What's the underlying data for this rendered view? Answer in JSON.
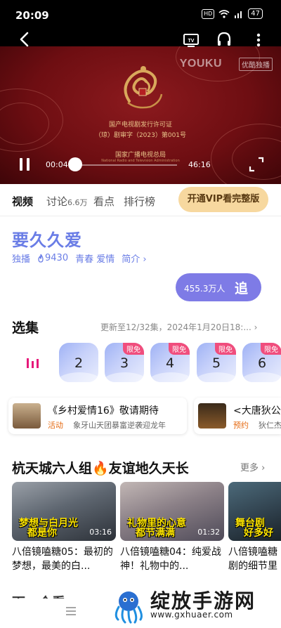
{
  "status_bar": {
    "time": "20:09",
    "hd": "HD",
    "battery": "47"
  },
  "player": {
    "brand": "YOUKU",
    "badge": "优酷独播",
    "cert_line1": "国产电视剧发行许可证",
    "cert_line2": "（琼）剧审字（2023）第001号",
    "cert_line3": "国家广播电视总局",
    "cert_line4": "National Radio and Television Administration",
    "current_time": "00:04",
    "total_time": "46:16",
    "progress": 0.0015
  },
  "tabs": [
    {
      "label": "视频",
      "count": ""
    },
    {
      "label": "讨论",
      "count": "6.6万"
    },
    {
      "label": "看点",
      "count": ""
    },
    {
      "label": "排行榜",
      "count": ""
    }
  ],
  "vip_button": "开通VIP看完整版",
  "show": {
    "title": "要久久爱",
    "exclusive": "独播",
    "heat": "9430",
    "genres": "青春 爱情",
    "intro": "简介"
  },
  "follow": {
    "count": "455.3万人",
    "label": "追"
  },
  "episodes": {
    "title": "选集",
    "update": "更新至12/32集，2024年1月20日18:...",
    "items": [
      {
        "num": "2",
        "tag": ""
      },
      {
        "num": "3",
        "tag": "限免"
      },
      {
        "num": "4",
        "tag": "限免"
      },
      {
        "num": "5",
        "tag": "限免"
      },
      {
        "num": "6",
        "tag": "限免"
      }
    ]
  },
  "promos": [
    {
      "title": "《乡村爱情16》敬请期待",
      "label": "活动",
      "sub": "象牙山天团暴富逆袭迎龙年"
    },
    {
      "title": "<大唐狄公",
      "label": "预约",
      "sub": "狄仁杰"
    }
  ],
  "row": {
    "title": "杭天城六人组🔥友谊地久天长",
    "more": "更多",
    "cards": [
      {
        "cap1": "梦想与白月光",
        "cap2": "都是你",
        "duration": "03:16",
        "desc": "八倍镜嗑糖05：最初的梦想，最美的白..."
      },
      {
        "cap1": "礼物里的心意",
        "cap2": "都节满满",
        "duration": "01:32",
        "desc": "八倍镜嗑糖04：纯爱战神！礼物中的..."
      },
      {
        "cap1": "舞台剧",
        "cap2": "好多好",
        "duration": "",
        "desc": "八倍镜嗑糖剧的细节里"
      }
    ]
  },
  "next_section": "下一个看",
  "watermark": {
    "text": "绽放手游网",
    "url": "www.gxhuaer.com"
  }
}
